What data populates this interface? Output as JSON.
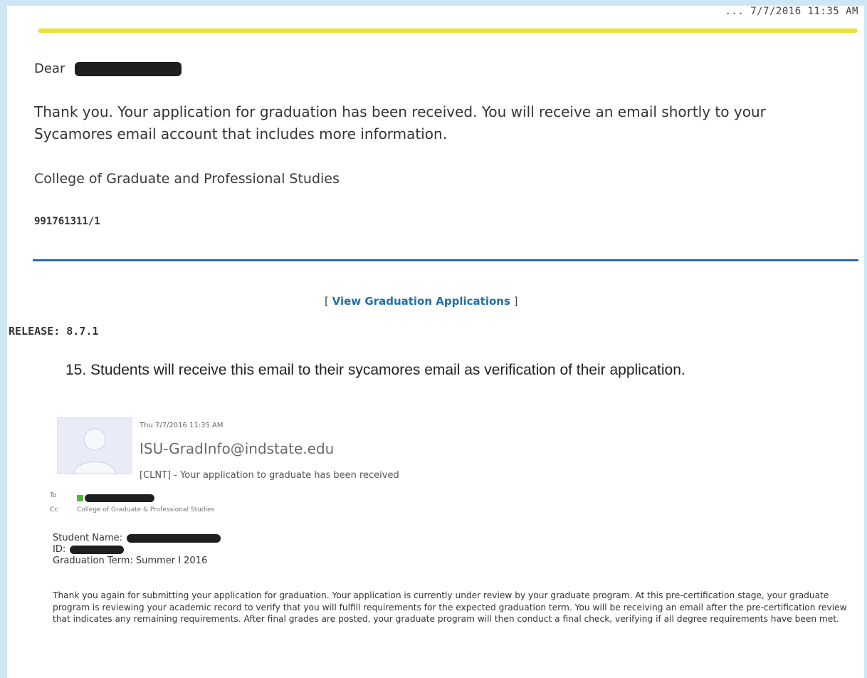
{
  "header": {
    "date_fragment": "... 7/7/2016 11:35 AM"
  },
  "letter": {
    "salutation": "Dear",
    "message": "Thank you. Your application for graduation has been received. You will receive an email shortly to your Sycamores email account that includes more information.",
    "signature": "College of Graduate and Professional Studies",
    "reference": "991761311/1"
  },
  "nav": {
    "bracket_open": "[",
    "view_link": "View Graduation Applications",
    "bracket_close": "]"
  },
  "release": "RELEASE: 8.7.1",
  "step": "15. Students will receive this email to their sycamores email as verification of their application.",
  "email": {
    "date": "Thu 7/7/2016 11:35 AM",
    "from": "ISU-GradInfo@indstate.edu",
    "subject": "[CLNT] -  Your application to graduate has been received",
    "to_label": "To",
    "cc_label": "Cc",
    "cc_value": "College of Graduate & Professional Studies",
    "student_name_label": "Student Name:",
    "id_label": "ID:",
    "graduation_term": "Graduation Term: Summer I 2016",
    "body": "Thank you again for submitting your application for graduation. Your application is currently under review by your graduate program. At this pre-certification stage, your graduate program is reviewing your academic record to verify that you will fulfill requirements for the expected graduation term. You will be receiving an email after the pre-certification review that indicates any remaining requirements. After final grades are posted, your graduate program will then conduct a final check, verifying if all degree requirements have been met."
  }
}
